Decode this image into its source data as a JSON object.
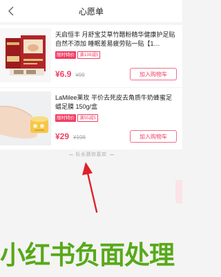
{
  "header": {
    "title": "心愿单"
  },
  "items": [
    {
      "title": "天启恒丰 月舒宝艾草竹醋粉精华健康护足贴 自然不添加 睡眠差易疲劳贴一贴【1…",
      "tag_special": "限时特价",
      "tag_discount": "满139减5",
      "price": "¥6.9",
      "original_price": "¥99",
      "cart_label": "加入购物车"
    },
    {
      "title": "LaMilee莱玫 平价去死皮去角质牛奶蜂蜜足蜡足膜 150g/盒",
      "tag_special": "限时特价",
      "tag_discount": "满55减5",
      "price": "¥29",
      "original_price": "¥198",
      "cart_label": "加入购物车"
    }
  ],
  "guess": {
    "label": "队长猜你喜欢"
  },
  "watermark": {
    "text": "小红书负面处理"
  },
  "colors": {
    "accent": "#f13e63",
    "watermark": "#58a91a",
    "arrow": "#e0202a"
  }
}
